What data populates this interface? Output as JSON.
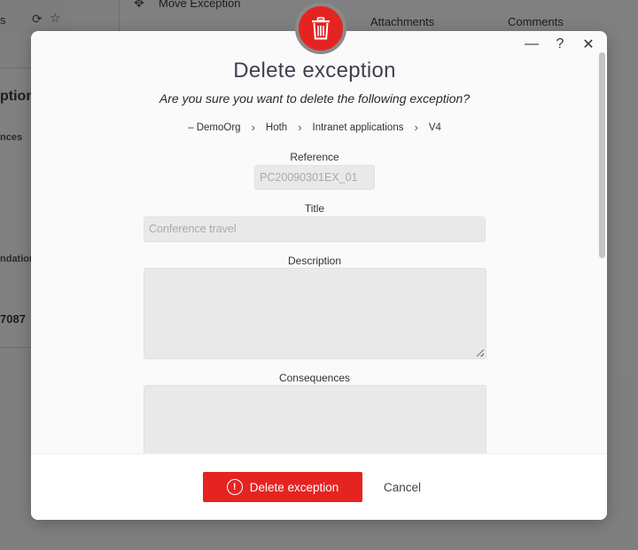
{
  "background": {
    "left_fragment_1": "s",
    "left_fragment_2": "ption",
    "left_fragment_3": "nces",
    "left_fragment_4": "ndation",
    "left_fragment_5": "7087",
    "move_exception": "Move Exception",
    "tab_attachments": "Attachments",
    "tab_comments": "Comments"
  },
  "modal": {
    "title": "Delete exception",
    "subtitle": "Are you sure you want to delete the following exception?",
    "breadcrumb": {
      "items": [
        "DemoOrg",
        "Hoth",
        "Intranet applications",
        "V4"
      ],
      "prefix": "–"
    },
    "fields": {
      "reference": {
        "label": "Reference",
        "value": "PC20090301EX_01"
      },
      "title": {
        "label": "Title",
        "value": "Conference travel"
      },
      "description": {
        "label": "Description",
        "value": ""
      },
      "consequences": {
        "label": "Consequences",
        "value": ""
      }
    },
    "window_controls": {
      "minimize": "—",
      "help": "?",
      "close": "✕"
    },
    "footer": {
      "delete_label": "Delete exception",
      "cancel_label": "Cancel"
    },
    "icons": {
      "badge": "trash-icon",
      "delete_button": "alert-circle-icon"
    },
    "colors": {
      "accent": "#e52421",
      "title": "#3f3f51",
      "input_bg": "#e9e9e9"
    }
  }
}
